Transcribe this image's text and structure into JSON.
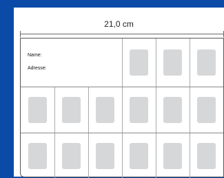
{
  "dimension": {
    "label": "21,0 cm"
  },
  "form": {
    "name_label": "Name:",
    "address_label": "Adresse:"
  },
  "colors": {
    "background": "#0c4aa8",
    "slot": "#d6d7d9"
  }
}
